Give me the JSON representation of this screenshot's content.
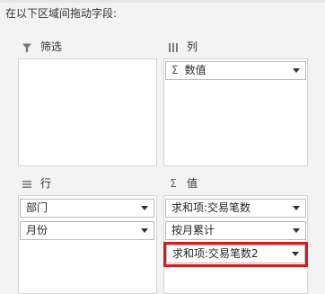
{
  "instruction": "在以下区域间拖动字段:",
  "zones": {
    "filter": {
      "title": "筛选",
      "icon": "filter-icon",
      "fields": []
    },
    "columns": {
      "title": "列",
      "icon": "columns-icon",
      "fields": [
        {
          "label": "数值",
          "sigma": "Σ"
        }
      ]
    },
    "rows": {
      "title": "行",
      "icon": "rows-icon",
      "fields": [
        {
          "label": "部门"
        },
        {
          "label": "月份"
        }
      ]
    },
    "values": {
      "title": "值",
      "icon": "sigma-icon",
      "icon_glyph": "Σ",
      "fields": [
        {
          "label": "求和项:交易笔数"
        },
        {
          "label": "按月累计"
        },
        {
          "label": "求和项:交易笔数2"
        }
      ]
    }
  },
  "colors": {
    "highlight": "#e0161d",
    "background": "#f3f3f3",
    "field_border": "#bcbcbc"
  }
}
